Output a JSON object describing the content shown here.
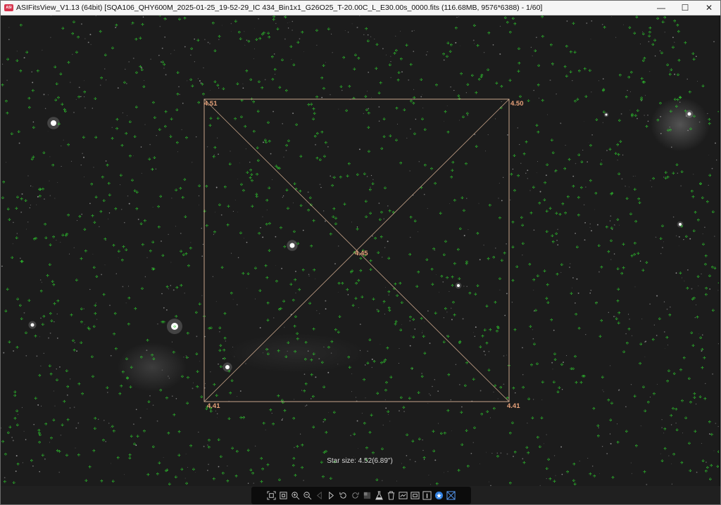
{
  "window": {
    "title": "ASIFitsView_V1.13 (64bit) [SQA106_QHY600M_2025-01-25_19-52-29_IC 434_Bin1x1_G26O25_T-20.00C_L_E30.00s_0000.fits (116.68MB, 9576*6388) - 1/60]",
    "controls": {
      "minimize": "—",
      "maximize": "☐",
      "close": "✕"
    }
  },
  "overlay": {
    "corner_values": {
      "top_left": "4.51",
      "top_right": "4.50",
      "bottom_left": "4.41",
      "bottom_right": "4.41",
      "center": "4.45"
    },
    "star_size_text": "Star size: 4.52(6.89\")",
    "colors": {
      "frame": "#c9a58a",
      "label": "#e8a27a",
      "star_marker": "#2fd12f"
    }
  },
  "toolbar": {
    "buttons": [
      {
        "name": "fit-window-icon",
        "enabled": true
      },
      {
        "name": "actual-size-icon",
        "enabled": true
      },
      {
        "name": "zoom-in-icon",
        "enabled": true
      },
      {
        "name": "zoom-out-icon",
        "enabled": true
      },
      {
        "name": "previous-icon",
        "enabled": false
      },
      {
        "name": "next-icon",
        "enabled": true
      },
      {
        "name": "rotate-left-icon",
        "enabled": true
      },
      {
        "name": "rotate-right-icon",
        "enabled": false
      },
      {
        "name": "stretch-icon",
        "enabled": false
      },
      {
        "name": "flask-icon",
        "enabled": true
      },
      {
        "name": "delete-icon",
        "enabled": true
      },
      {
        "name": "save-icon",
        "enabled": true
      },
      {
        "name": "crop-icon",
        "enabled": true
      },
      {
        "name": "info-icon",
        "enabled": true
      },
      {
        "name": "star-detect-icon",
        "enabled": true
      },
      {
        "name": "tilt-analysis-icon",
        "enabled": true
      }
    ]
  }
}
